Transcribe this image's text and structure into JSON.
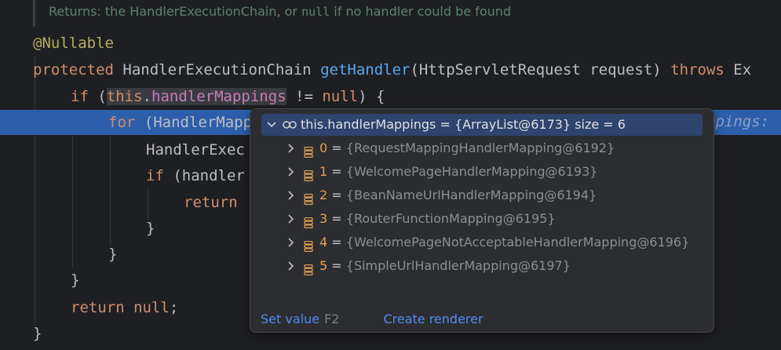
{
  "doc_comment": {
    "prefix": "Returns: the HandlerExecutionChain, or ",
    "code": "null",
    "suffix": " if no handler could be found"
  },
  "code": {
    "annotation": "@Nullable",
    "l2_protected": "protected",
    "l2_type": " HandlerExecutionChain ",
    "l2_method": "getHandler",
    "l2_params": "(HttpServletRequest request) ",
    "l2_throws": "throws",
    "l2_tail": " Ex",
    "l3_if": "if",
    "l3_open": " (",
    "l3_this": "this",
    "l3_dot": ".",
    "l3_field": "handlerMappings",
    "l3_ne": " != ",
    "l3_null": "null",
    "l3_close": ") {",
    "l4_for": "for",
    "l4_rest": " (HandlerMapp",
    "l4_hint": "ppings:",
    "l5_text": "HandlerExec",
    "l6_if": "if",
    "l6_rest": " (handler",
    "l7_return": "return",
    "l8_brace": "}",
    "l9_brace": "}",
    "l10_brace": "}",
    "l11_return": "return",
    "l11_null": "null",
    "l11_semi": ";",
    "l12_brace": "}"
  },
  "popup": {
    "root_label": "this.handlerMappings = {ArrayList@6173}  size = 6",
    "items": [
      {
        "index": "0",
        "sep": " = ",
        "value": "{RequestMappingHandlerMapping@6192}"
      },
      {
        "index": "1",
        "sep": " = ",
        "value": "{WelcomePageHandlerMapping@6193}"
      },
      {
        "index": "2",
        "sep": " = ",
        "value": "{BeanNameUrlHandlerMapping@6194}"
      },
      {
        "index": "3",
        "sep": " = ",
        "value": "{RouterFunctionMapping@6195}"
      },
      {
        "index": "4",
        "sep": " = ",
        "value": "{WelcomePageNotAcceptableHandlerMapping@6196}"
      },
      {
        "index": "5",
        "sep": " = ",
        "value": "{SimpleUrlHandlerMapping@6197}"
      }
    ],
    "set_value": "Set value",
    "set_value_key": "F2",
    "create_renderer": "Create renderer"
  },
  "colors": {
    "background": "#1e1f22",
    "keyword": "#cf8e6d",
    "annotation": "#b3ae60",
    "method": "#56a8f5",
    "field": "#c77dbb",
    "execution_line": "#2d5eab",
    "link": "#548af7",
    "index": "#e8a053"
  },
  "icons": [
    "chevron-down-icon",
    "infinity-icon",
    "chevron-right-icon",
    "stack-icon"
  ]
}
